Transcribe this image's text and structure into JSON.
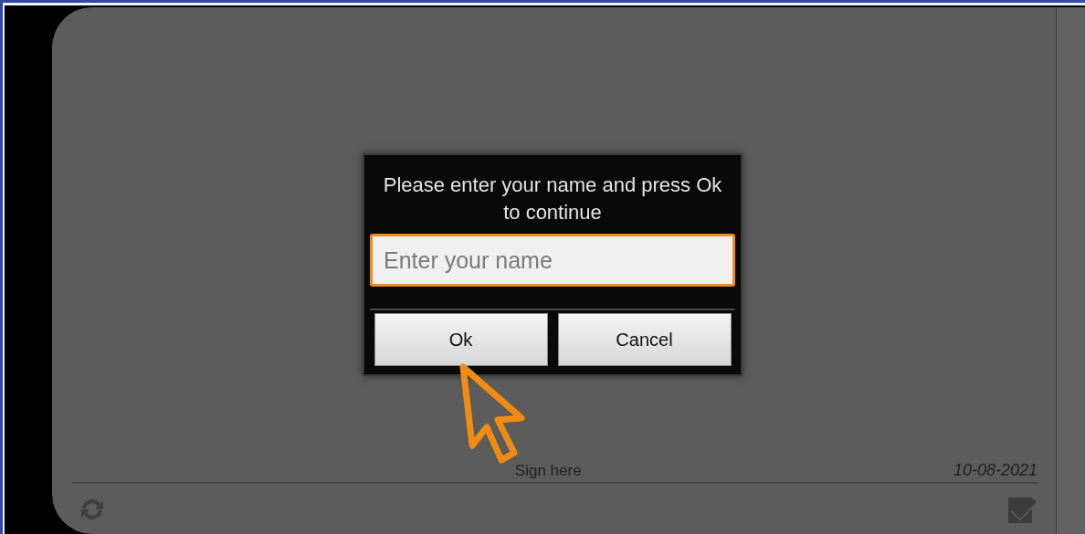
{
  "dialog": {
    "message": "Please enter your name and press Ok to continue",
    "name_field": {
      "placeholder": "Enter your name",
      "focused": true
    },
    "buttons": [
      {
        "label": "Ok"
      },
      {
        "label": "Cancel"
      }
    ]
  },
  "signature_pad": {
    "hint": "Sign here",
    "date": "10-08-2021"
  }
}
